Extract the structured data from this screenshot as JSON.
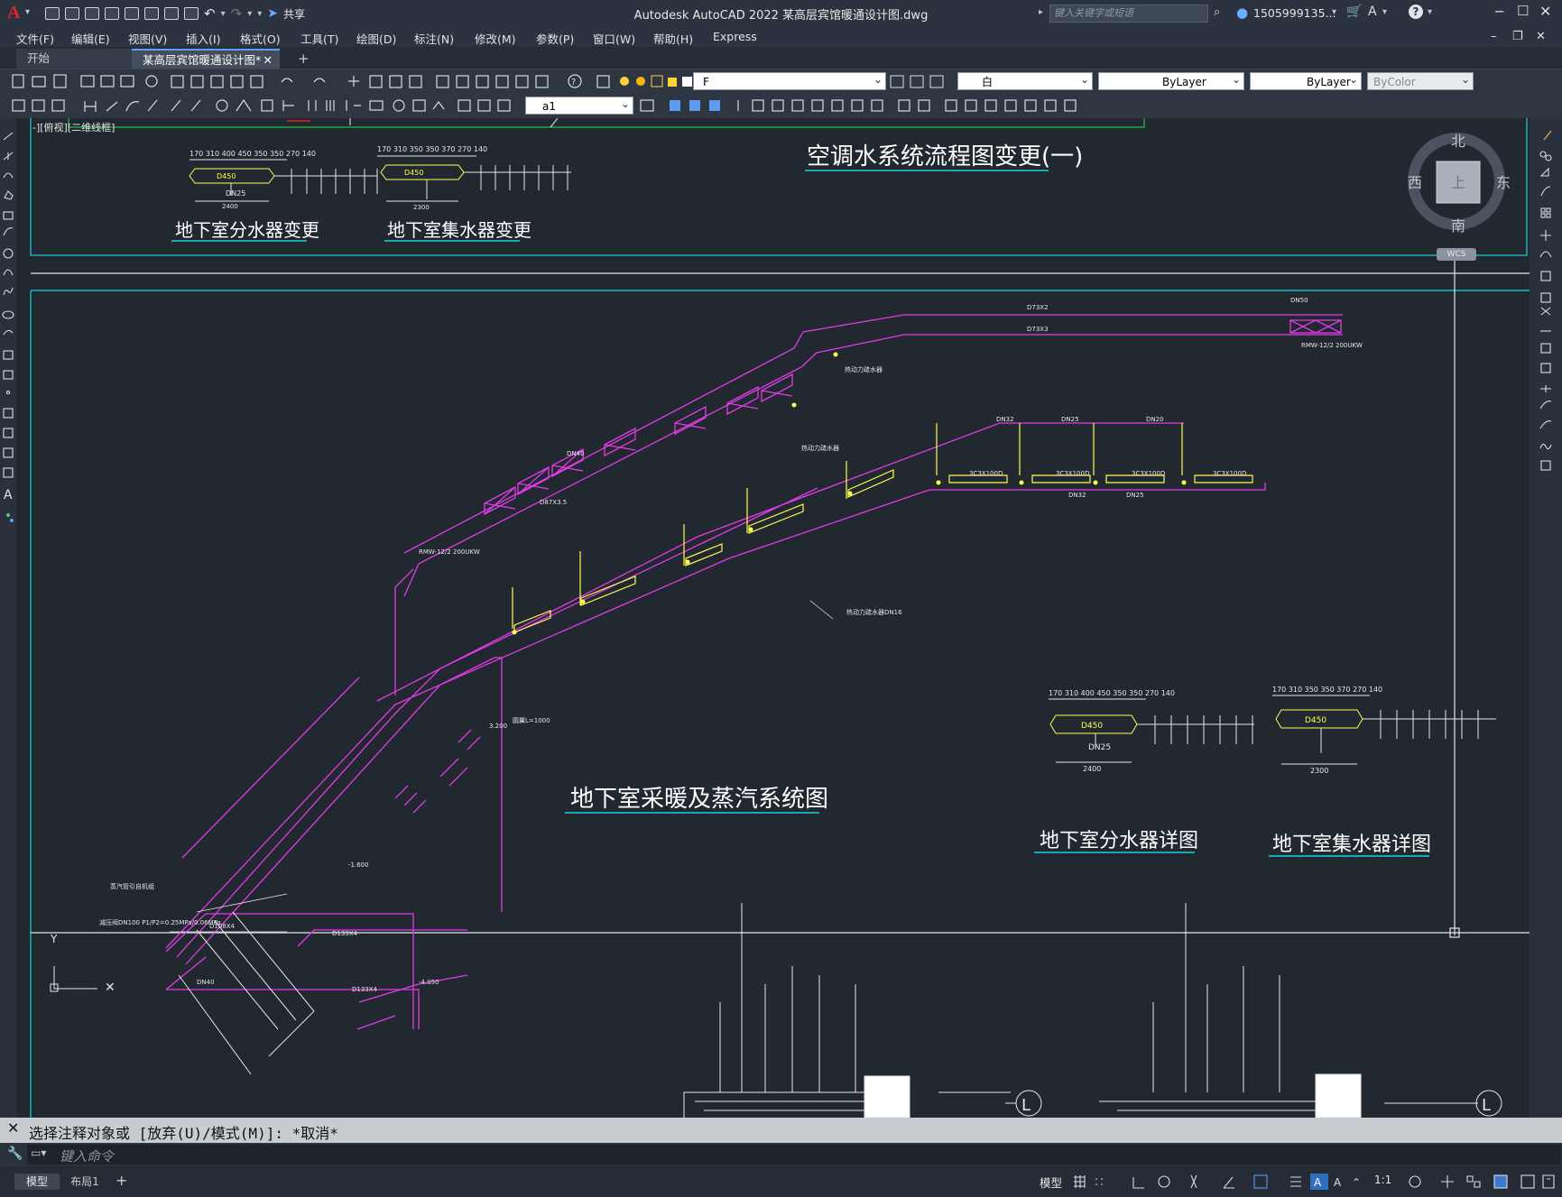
{
  "titlebar": {
    "app_title": "Autodesk AutoCAD 2022    某高层宾馆暖通设计图.dwg",
    "share_label": "共享",
    "search_placeholder": "键入关键字或短语",
    "user": "1505999135...",
    "logo": "A"
  },
  "menu": [
    "文件(F)",
    "编辑(E)",
    "视图(V)",
    "插入(I)",
    "格式(O)",
    "工具(T)",
    "绘图(D)",
    "标注(N)",
    "修改(M)",
    "参数(P)",
    "窗口(W)",
    "帮助(H)",
    "Express"
  ],
  "tabs": [
    {
      "label": "开始"
    },
    {
      "label": "某高层宾馆暖通设计图*"
    }
  ],
  "toolbar": {
    "layer_value": "F",
    "color_value": "白",
    "linetype_value": "ByLayer",
    "lineweight_value": "ByLayer",
    "plotstyle_value": "ByColor",
    "textstyle_value": "a1"
  },
  "viewport_label": "-][俯视][二维线框]",
  "viewcube": {
    "north": "北",
    "south": "南",
    "east": "东",
    "west": "西",
    "top": "上",
    "wcs": "WCS"
  },
  "drawing": {
    "title_flow": "空调水系统流程图变更(一)",
    "title_basement_dist_change": "地下室分水器变更",
    "title_basement_coll_change": "地下室集水器变更",
    "title_heating": "地下室采暖及蒸汽系统图",
    "title_dist_detail": "地下室分水器详图",
    "title_coll_detail": "地下室集水器详图",
    "lbl_d450": "D450",
    "lbl_dn25": "DN25",
    "lbl_2400": "2400",
    "lbl_2300": "2300",
    "lbl_dims_dist": "170 310  400  450  350 350 270 140",
    "lbl_dims_coll": "170  310  350  350 370 270 140",
    "lbl_d73x2": "D73X2",
    "lbl_d73x3": "D73X3",
    "lbl_dn50": "DN50",
    "lbl_rmw": "RMW-12/2  200UKW",
    "lbl_rmw2": "RMW-12/2  200UKW",
    "lbl_valve1": "热动力疏水器",
    "lbl_valve2": "热动力疏水器DN16",
    "lbl_dn32": "DN32",
    "lbl_dn40": "DN40",
    "lbl_dn20": "DN20",
    "lbl_d87x35": "D87X3.5",
    "lbl_rad": "3C3X100D",
    "lbl_tube": "圆翼L=1000",
    "lbl_minus1600": "-1.600",
    "lbl_minus4050": "-4.050",
    "lbl_3200": "3.200",
    "lbl_steam": "蒸汽管引自机组",
    "lbl_reduce": "减压阀DN100 P1/P2=0.25MPa/0.06MPa",
    "lbl_d133x4": "D133X4",
    "lbl_d108x4": "D108X4"
  },
  "command": {
    "history": "选择注释对象或 [放弃(U)/模式(M)]: *取消*",
    "prompt_placeholder": "键入命令"
  },
  "status": {
    "model_tab": "模型",
    "layout_tab": "布局1",
    "model_label": "模型",
    "scale": "1:1"
  },
  "colors": {
    "magenta": "#e13be6",
    "yellow": "#ffff52",
    "cyan": "#19d3dc",
    "green": "#1ec83a",
    "white": "#ffffff",
    "canvas": "#212830"
  }
}
